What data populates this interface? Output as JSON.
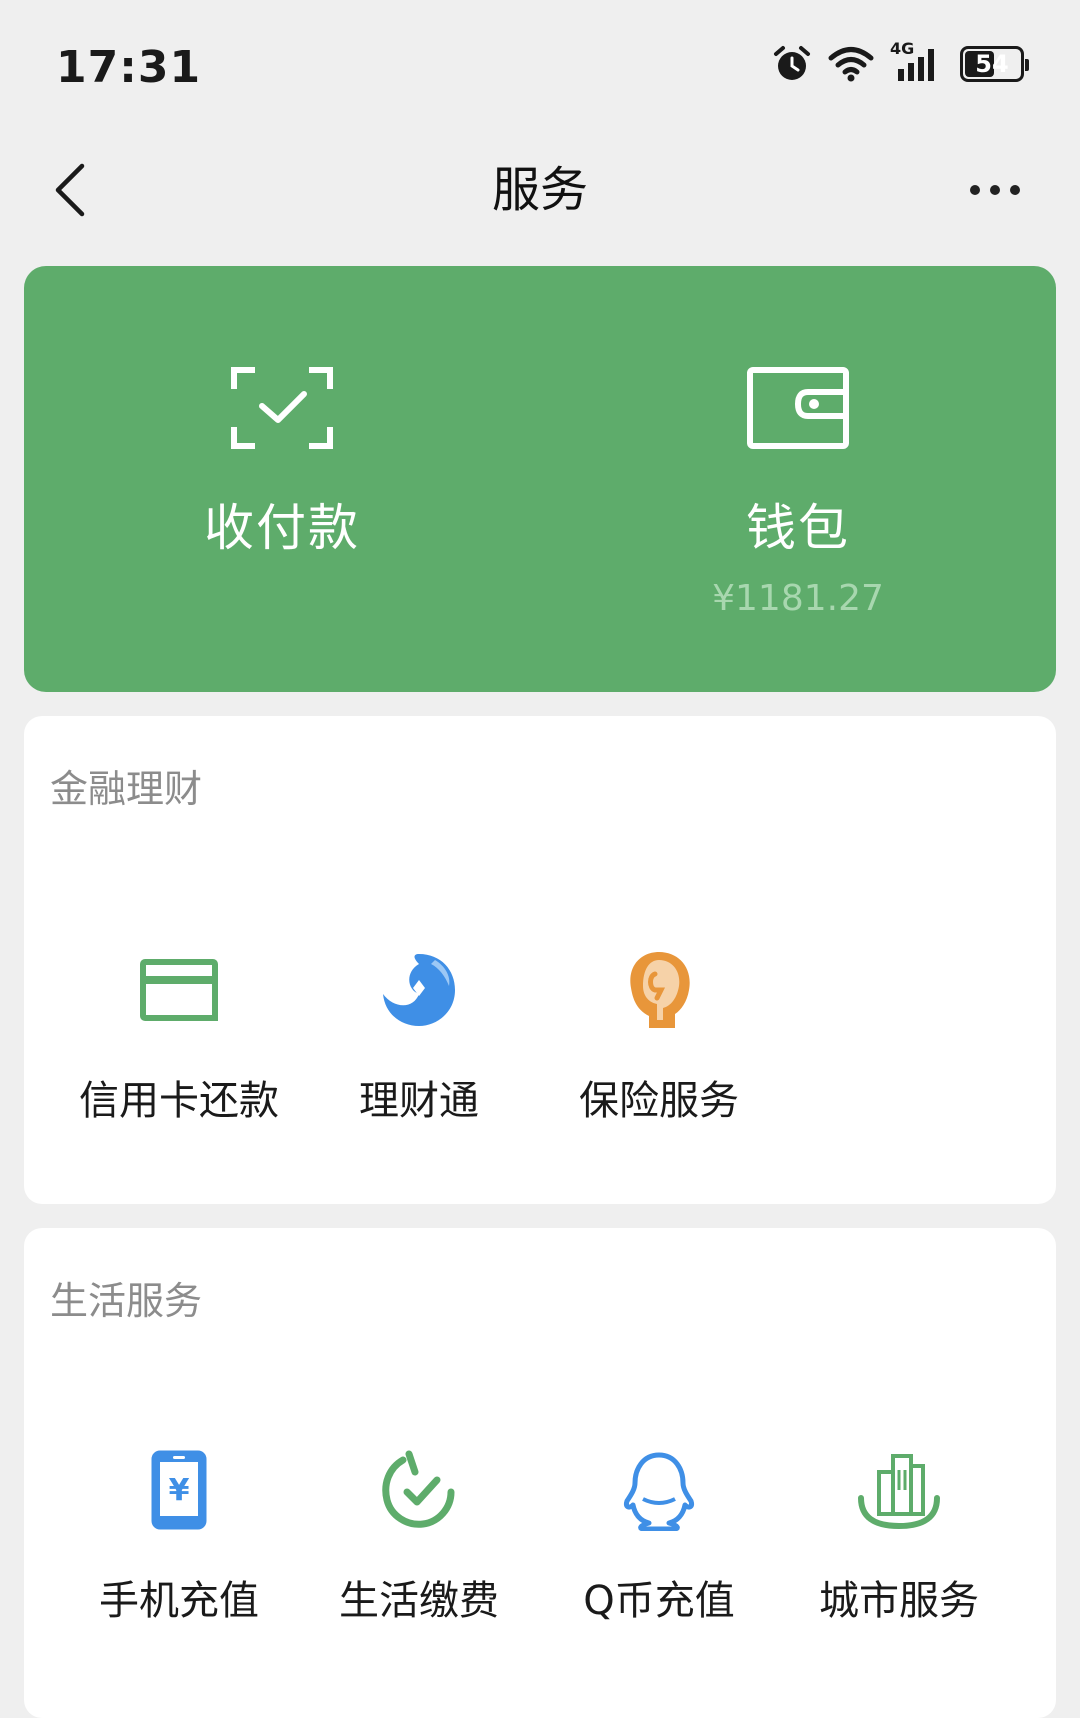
{
  "status_bar": {
    "time": "17:31",
    "network": "4G",
    "battery_level": 54,
    "battery_text": "54"
  },
  "nav": {
    "title": "服务"
  },
  "pay_card": {
    "accent_color": "#5eac6b",
    "payment": {
      "label": "收付款",
      "icon": "scan-check-icon"
    },
    "wallet": {
      "label": "钱包",
      "balance": "¥1181.27",
      "icon": "wallet-icon"
    }
  },
  "finance": {
    "title": "金融理财",
    "items": [
      {
        "label": "信用卡还款",
        "icon": "credit-card-icon",
        "color": "#5eac6b"
      },
      {
        "label": "理财通",
        "icon": "wealth-icon",
        "color": "#3f8fe6"
      },
      {
        "label": "保险服务",
        "icon": "insurance-icon",
        "color": "#e8963a"
      }
    ]
  },
  "life": {
    "title": "生活服务",
    "items": [
      {
        "label": "手机充值",
        "icon": "phone-topup-icon",
        "color": "#3f8fe6"
      },
      {
        "label": "生活缴费",
        "icon": "bill-payment-icon",
        "color": "#5eac6b"
      },
      {
        "label": "Q币充值",
        "icon": "qq-penguin-icon",
        "color": "#3f8fe6"
      },
      {
        "label": "城市服务",
        "icon": "city-service-icon",
        "color": "#5eac6b"
      }
    ]
  }
}
